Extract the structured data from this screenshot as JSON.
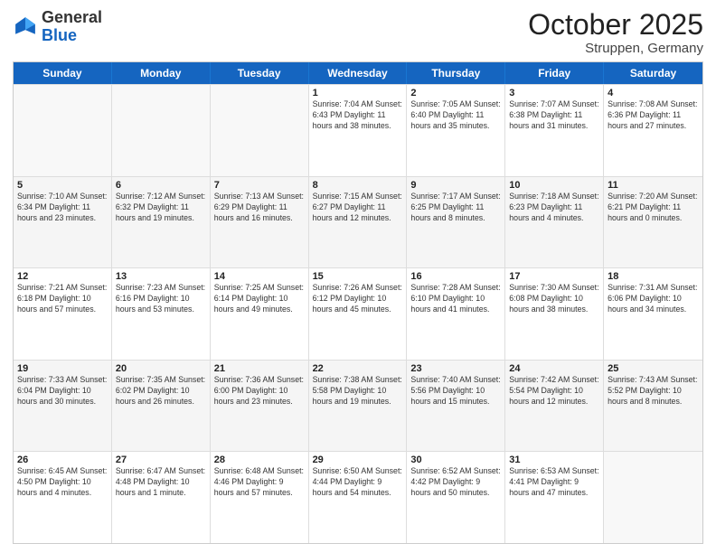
{
  "header": {
    "logo": {
      "general": "General",
      "blue": "Blue"
    },
    "title": "October 2025",
    "subtitle": "Struppen, Germany"
  },
  "weekdays": [
    "Sunday",
    "Monday",
    "Tuesday",
    "Wednesday",
    "Thursday",
    "Friday",
    "Saturday"
  ],
  "rows": [
    {
      "alt": false,
      "cells": [
        {
          "day": "",
          "info": ""
        },
        {
          "day": "",
          "info": ""
        },
        {
          "day": "",
          "info": ""
        },
        {
          "day": "1",
          "info": "Sunrise: 7:04 AM\nSunset: 6:43 PM\nDaylight: 11 hours\nand 38 minutes."
        },
        {
          "day": "2",
          "info": "Sunrise: 7:05 AM\nSunset: 6:40 PM\nDaylight: 11 hours\nand 35 minutes."
        },
        {
          "day": "3",
          "info": "Sunrise: 7:07 AM\nSunset: 6:38 PM\nDaylight: 11 hours\nand 31 minutes."
        },
        {
          "day": "4",
          "info": "Sunrise: 7:08 AM\nSunset: 6:36 PM\nDaylight: 11 hours\nand 27 minutes."
        }
      ]
    },
    {
      "alt": true,
      "cells": [
        {
          "day": "5",
          "info": "Sunrise: 7:10 AM\nSunset: 6:34 PM\nDaylight: 11 hours\nand 23 minutes."
        },
        {
          "day": "6",
          "info": "Sunrise: 7:12 AM\nSunset: 6:32 PM\nDaylight: 11 hours\nand 19 minutes."
        },
        {
          "day": "7",
          "info": "Sunrise: 7:13 AM\nSunset: 6:29 PM\nDaylight: 11 hours\nand 16 minutes."
        },
        {
          "day": "8",
          "info": "Sunrise: 7:15 AM\nSunset: 6:27 PM\nDaylight: 11 hours\nand 12 minutes."
        },
        {
          "day": "9",
          "info": "Sunrise: 7:17 AM\nSunset: 6:25 PM\nDaylight: 11 hours\nand 8 minutes."
        },
        {
          "day": "10",
          "info": "Sunrise: 7:18 AM\nSunset: 6:23 PM\nDaylight: 11 hours\nand 4 minutes."
        },
        {
          "day": "11",
          "info": "Sunrise: 7:20 AM\nSunset: 6:21 PM\nDaylight: 11 hours\nand 0 minutes."
        }
      ]
    },
    {
      "alt": false,
      "cells": [
        {
          "day": "12",
          "info": "Sunrise: 7:21 AM\nSunset: 6:18 PM\nDaylight: 10 hours\nand 57 minutes."
        },
        {
          "day": "13",
          "info": "Sunrise: 7:23 AM\nSunset: 6:16 PM\nDaylight: 10 hours\nand 53 minutes."
        },
        {
          "day": "14",
          "info": "Sunrise: 7:25 AM\nSunset: 6:14 PM\nDaylight: 10 hours\nand 49 minutes."
        },
        {
          "day": "15",
          "info": "Sunrise: 7:26 AM\nSunset: 6:12 PM\nDaylight: 10 hours\nand 45 minutes."
        },
        {
          "day": "16",
          "info": "Sunrise: 7:28 AM\nSunset: 6:10 PM\nDaylight: 10 hours\nand 41 minutes."
        },
        {
          "day": "17",
          "info": "Sunrise: 7:30 AM\nSunset: 6:08 PM\nDaylight: 10 hours\nand 38 minutes."
        },
        {
          "day": "18",
          "info": "Sunrise: 7:31 AM\nSunset: 6:06 PM\nDaylight: 10 hours\nand 34 minutes."
        }
      ]
    },
    {
      "alt": true,
      "cells": [
        {
          "day": "19",
          "info": "Sunrise: 7:33 AM\nSunset: 6:04 PM\nDaylight: 10 hours\nand 30 minutes."
        },
        {
          "day": "20",
          "info": "Sunrise: 7:35 AM\nSunset: 6:02 PM\nDaylight: 10 hours\nand 26 minutes."
        },
        {
          "day": "21",
          "info": "Sunrise: 7:36 AM\nSunset: 6:00 PM\nDaylight: 10 hours\nand 23 minutes."
        },
        {
          "day": "22",
          "info": "Sunrise: 7:38 AM\nSunset: 5:58 PM\nDaylight: 10 hours\nand 19 minutes."
        },
        {
          "day": "23",
          "info": "Sunrise: 7:40 AM\nSunset: 5:56 PM\nDaylight: 10 hours\nand 15 minutes."
        },
        {
          "day": "24",
          "info": "Sunrise: 7:42 AM\nSunset: 5:54 PM\nDaylight: 10 hours\nand 12 minutes."
        },
        {
          "day": "25",
          "info": "Sunrise: 7:43 AM\nSunset: 5:52 PM\nDaylight: 10 hours\nand 8 minutes."
        }
      ]
    },
    {
      "alt": false,
      "cells": [
        {
          "day": "26",
          "info": "Sunrise: 6:45 AM\nSunset: 4:50 PM\nDaylight: 10 hours\nand 4 minutes."
        },
        {
          "day": "27",
          "info": "Sunrise: 6:47 AM\nSunset: 4:48 PM\nDaylight: 10 hours\nand 1 minute."
        },
        {
          "day": "28",
          "info": "Sunrise: 6:48 AM\nSunset: 4:46 PM\nDaylight: 9 hours\nand 57 minutes."
        },
        {
          "day": "29",
          "info": "Sunrise: 6:50 AM\nSunset: 4:44 PM\nDaylight: 9 hours\nand 54 minutes."
        },
        {
          "day": "30",
          "info": "Sunrise: 6:52 AM\nSunset: 4:42 PM\nDaylight: 9 hours\nand 50 minutes."
        },
        {
          "day": "31",
          "info": "Sunrise: 6:53 AM\nSunset: 4:41 PM\nDaylight: 9 hours\nand 47 minutes."
        },
        {
          "day": "",
          "info": ""
        }
      ]
    }
  ]
}
